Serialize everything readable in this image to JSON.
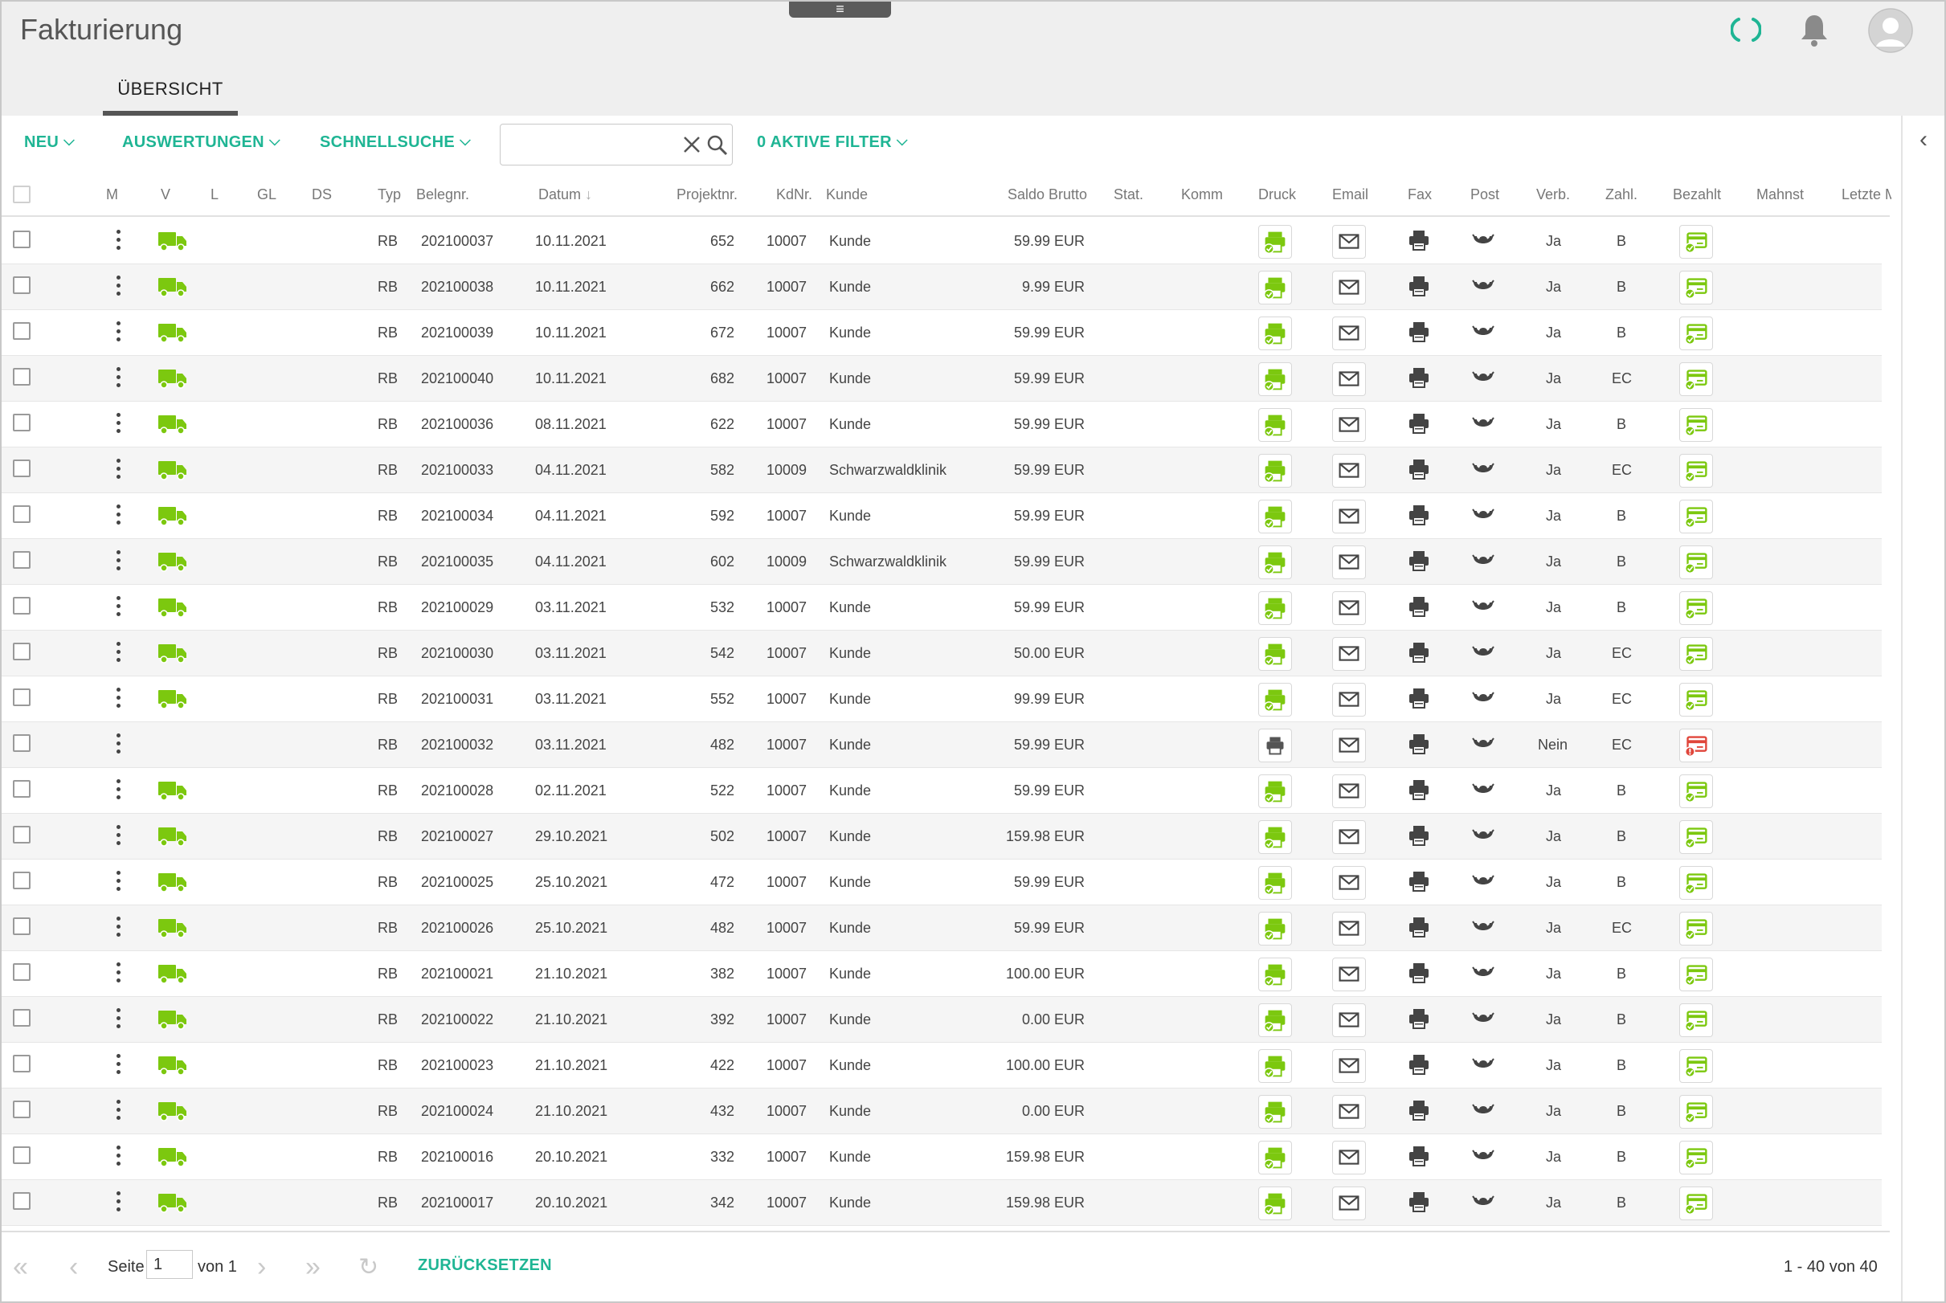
{
  "app": {
    "title": "Fakturierung",
    "menu_handle": "≡"
  },
  "tabs": [
    {
      "label": "ÜBERSICHT",
      "active": true
    }
  ],
  "toolbar": {
    "new_label": "NEU",
    "reports_label": "AUSWERTUNGEN",
    "quicksearch_label": "SCHNELLSUCHE",
    "search_value": "",
    "filters_label": "0 AKTIVE FILTER"
  },
  "columns": {
    "m": "M",
    "v": "V",
    "l": "L",
    "gl": "GL",
    "ds": "DS",
    "typ": "Typ",
    "belegnr": "Belegnr.",
    "datum": "Datum",
    "projektnr": "Projektnr.",
    "kdnr": "KdNr.",
    "kunde": "Kunde",
    "saldo": "Saldo Brutto",
    "stat": "Stat.",
    "komm": "Komm",
    "druck": "Druck",
    "email": "Email",
    "fax": "Fax",
    "post": "Post",
    "verb": "Verb.",
    "zahl": "Zahl.",
    "bezahlt": "Bezahlt",
    "mahnst": "Mahnst",
    "letzte": "Letzte M"
  },
  "colors": {
    "accent": "#1fb594",
    "icon_green": "#7cc80f",
    "warning_red": "#e0463b"
  },
  "rows": [
    {
      "typ": "RB",
      "belegnr": "202100037",
      "datum": "10.11.2021",
      "projektnr": "652",
      "kdnr": "10007",
      "kunde": "Kunde",
      "saldo": "59.99 EUR",
      "verb": "Ja",
      "zahl": "B",
      "delivered": true,
      "printed": true,
      "paid": true
    },
    {
      "typ": "RB",
      "belegnr": "202100038",
      "datum": "10.11.2021",
      "projektnr": "662",
      "kdnr": "10007",
      "kunde": "Kunde",
      "saldo": "9.99 EUR",
      "verb": "Ja",
      "zahl": "B",
      "delivered": true,
      "printed": true,
      "paid": true
    },
    {
      "typ": "RB",
      "belegnr": "202100039",
      "datum": "10.11.2021",
      "projektnr": "672",
      "kdnr": "10007",
      "kunde": "Kunde",
      "saldo": "59.99 EUR",
      "verb": "Ja",
      "zahl": "B",
      "delivered": true,
      "printed": true,
      "paid": true
    },
    {
      "typ": "RB",
      "belegnr": "202100040",
      "datum": "10.11.2021",
      "projektnr": "682",
      "kdnr": "10007",
      "kunde": "Kunde",
      "saldo": "59.99 EUR",
      "verb": "Ja",
      "zahl": "EC",
      "delivered": true,
      "printed": true,
      "paid": true
    },
    {
      "typ": "RB",
      "belegnr": "202100036",
      "datum": "08.11.2021",
      "projektnr": "622",
      "kdnr": "10007",
      "kunde": "Kunde",
      "saldo": "59.99 EUR",
      "verb": "Ja",
      "zahl": "B",
      "delivered": true,
      "printed": true,
      "paid": true
    },
    {
      "typ": "RB",
      "belegnr": "202100033",
      "datum": "04.11.2021",
      "projektnr": "582",
      "kdnr": "10009",
      "kunde": "Schwarzwaldklinik",
      "saldo": "59.99 EUR",
      "verb": "Ja",
      "zahl": "EC",
      "delivered": true,
      "printed": true,
      "paid": true
    },
    {
      "typ": "RB",
      "belegnr": "202100034",
      "datum": "04.11.2021",
      "projektnr": "592",
      "kdnr": "10007",
      "kunde": "Kunde",
      "saldo": "59.99 EUR",
      "verb": "Ja",
      "zahl": "B",
      "delivered": true,
      "printed": true,
      "paid": true
    },
    {
      "typ": "RB",
      "belegnr": "202100035",
      "datum": "04.11.2021",
      "projektnr": "602",
      "kdnr": "10009",
      "kunde": "Schwarzwaldklinik",
      "saldo": "59.99 EUR",
      "verb": "Ja",
      "zahl": "B",
      "delivered": true,
      "printed": true,
      "paid": true
    },
    {
      "typ": "RB",
      "belegnr": "202100029",
      "datum": "03.11.2021",
      "projektnr": "532",
      "kdnr": "10007",
      "kunde": "Kunde",
      "saldo": "59.99 EUR",
      "verb": "Ja",
      "zahl": "B",
      "delivered": true,
      "printed": true,
      "paid": true
    },
    {
      "typ": "RB",
      "belegnr": "202100030",
      "datum": "03.11.2021",
      "projektnr": "542",
      "kdnr": "10007",
      "kunde": "Kunde",
      "saldo": "50.00 EUR",
      "verb": "Ja",
      "zahl": "EC",
      "delivered": true,
      "printed": true,
      "paid": true
    },
    {
      "typ": "RB",
      "belegnr": "202100031",
      "datum": "03.11.2021",
      "projektnr": "552",
      "kdnr": "10007",
      "kunde": "Kunde",
      "saldo": "99.99 EUR",
      "verb": "Ja",
      "zahl": "EC",
      "delivered": true,
      "printed": true,
      "paid": true
    },
    {
      "typ": "RB",
      "belegnr": "202100032",
      "datum": "03.11.2021",
      "projektnr": "482",
      "kdnr": "10007",
      "kunde": "Kunde",
      "saldo": "59.99 EUR",
      "verb": "Nein",
      "zahl": "EC",
      "delivered": false,
      "printed": false,
      "paid": false
    },
    {
      "typ": "RB",
      "belegnr": "202100028",
      "datum": "02.11.2021",
      "projektnr": "522",
      "kdnr": "10007",
      "kunde": "Kunde",
      "saldo": "59.99 EUR",
      "verb": "Ja",
      "zahl": "B",
      "delivered": true,
      "printed": true,
      "paid": true
    },
    {
      "typ": "RB",
      "belegnr": "202100027",
      "datum": "29.10.2021",
      "projektnr": "502",
      "kdnr": "10007",
      "kunde": "Kunde",
      "saldo": "159.98 EUR",
      "verb": "Ja",
      "zahl": "B",
      "delivered": true,
      "printed": true,
      "paid": true
    },
    {
      "typ": "RB",
      "belegnr": "202100025",
      "datum": "25.10.2021",
      "projektnr": "472",
      "kdnr": "10007",
      "kunde": "Kunde",
      "saldo": "59.99 EUR",
      "verb": "Ja",
      "zahl": "B",
      "delivered": true,
      "printed": true,
      "paid": true
    },
    {
      "typ": "RB",
      "belegnr": "202100026",
      "datum": "25.10.2021",
      "projektnr": "482",
      "kdnr": "10007",
      "kunde": "Kunde",
      "saldo": "59.99 EUR",
      "verb": "Ja",
      "zahl": "EC",
      "delivered": true,
      "printed": true,
      "paid": true
    },
    {
      "typ": "RB",
      "belegnr": "202100021",
      "datum": "21.10.2021",
      "projektnr": "382",
      "kdnr": "10007",
      "kunde": "Kunde",
      "saldo": "100.00 EUR",
      "verb": "Ja",
      "zahl": "B",
      "delivered": true,
      "printed": true,
      "paid": true
    },
    {
      "typ": "RB",
      "belegnr": "202100022",
      "datum": "21.10.2021",
      "projektnr": "392",
      "kdnr": "10007",
      "kunde": "Kunde",
      "saldo": "0.00 EUR",
      "verb": "Ja",
      "zahl": "B",
      "delivered": true,
      "printed": true,
      "paid": true
    },
    {
      "typ": "RB",
      "belegnr": "202100023",
      "datum": "21.10.2021",
      "projektnr": "422",
      "kdnr": "10007",
      "kunde": "Kunde",
      "saldo": "100.00 EUR",
      "verb": "Ja",
      "zahl": "B",
      "delivered": true,
      "printed": true,
      "paid": true
    },
    {
      "typ": "RB",
      "belegnr": "202100024",
      "datum": "21.10.2021",
      "projektnr": "432",
      "kdnr": "10007",
      "kunde": "Kunde",
      "saldo": "0.00 EUR",
      "verb": "Ja",
      "zahl": "B",
      "delivered": true,
      "printed": true,
      "paid": true
    },
    {
      "typ": "RB",
      "belegnr": "202100016",
      "datum": "20.10.2021",
      "projektnr": "332",
      "kdnr": "10007",
      "kunde": "Kunde",
      "saldo": "159.98 EUR",
      "verb": "Ja",
      "zahl": "B",
      "delivered": true,
      "printed": true,
      "paid": true
    },
    {
      "typ": "RB",
      "belegnr": "202100017",
      "datum": "20.10.2021",
      "projektnr": "342",
      "kdnr": "10007",
      "kunde": "Kunde",
      "saldo": "159.98 EUR",
      "verb": "Ja",
      "zahl": "B",
      "delivered": true,
      "printed": true,
      "paid": true
    }
  ],
  "pagination": {
    "page_label": "Seite",
    "page_value": "1",
    "of_label": "von 1",
    "reset_label": "ZURÜCKSETZEN",
    "count_text": "1 - 40 von 40"
  }
}
